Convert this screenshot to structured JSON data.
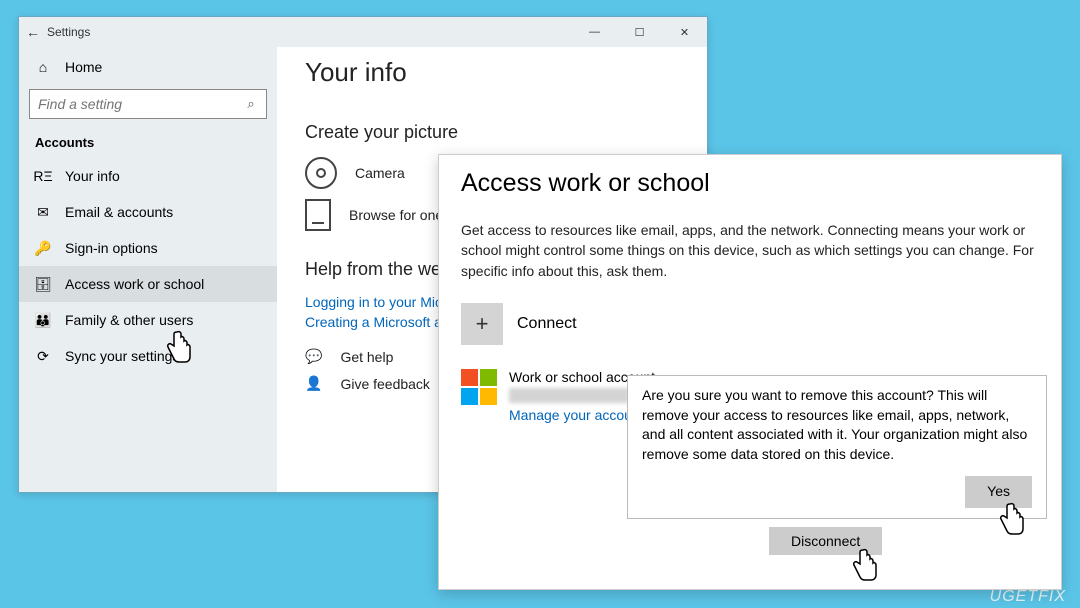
{
  "window1": {
    "title": "Settings",
    "home": "Home",
    "search_placeholder": "Find a setting",
    "category": "Accounts",
    "nav": [
      {
        "icon": "person-card-icon",
        "glyph": "RΞ",
        "label": "Your info"
      },
      {
        "icon": "envelope-icon",
        "glyph": "✉",
        "label": "Email & accounts"
      },
      {
        "icon": "key-icon",
        "glyph": "🔑",
        "label": "Sign-in options"
      },
      {
        "icon": "briefcase-icon",
        "glyph": "🗄",
        "label": "Access work or school"
      },
      {
        "icon": "family-icon",
        "glyph": "👪",
        "label": "Family & other users"
      },
      {
        "icon": "sync-icon",
        "glyph": "⟳",
        "label": "Sync your settings"
      }
    ],
    "selected_index": 3
  },
  "your_info": {
    "title": "Your info",
    "section1": "Create your picture",
    "camera": "Camera",
    "browse": "Browse for one",
    "section2": "Help from the web",
    "link1": "Logging in to your Microsoft account",
    "link2": "Creating a Microsoft account",
    "get_help": "Get help",
    "feedback": "Give feedback"
  },
  "window2": {
    "title": "Access work or school",
    "description": "Get access to resources like email, apps, and the network. Connecting means your work or school might control some things on this device, such as which settings you can change. For specific info about this, ask them.",
    "connect": "Connect",
    "account_label": "Work or school account",
    "manage_link": "Manage your account",
    "disconnect": "Disconnect"
  },
  "confirm": {
    "text": "Are you sure you want to remove this account? This will remove your access to resources like email, apps, network, and all content associated with it. Your organization might also remove some data stored on this device.",
    "yes": "Yes"
  },
  "watermark": "UGETFIX"
}
